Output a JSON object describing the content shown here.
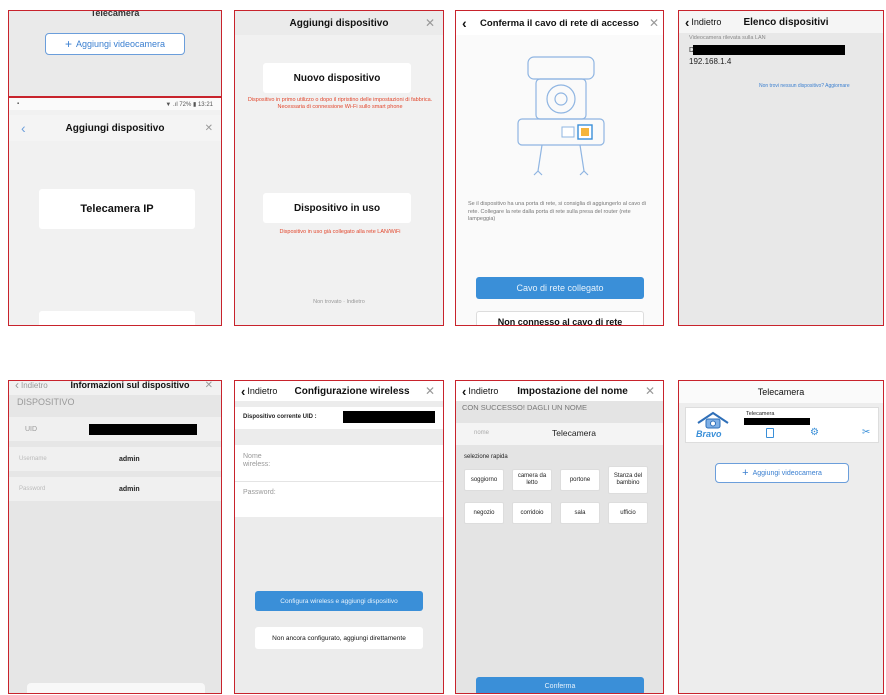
{
  "p1": {
    "top_title": "Telecamera",
    "add_camera_label": "Aggiungi videocamera",
    "status_icon": "notification-icon",
    "status_right": "▼ .ıl 72% ▮ 13:21",
    "header_title": "Aggiungi dispositivo",
    "camera_option": "Telecamera IP"
  },
  "p2": {
    "header_title": "Aggiungi dispositivo",
    "new_device": "Nuovo dispositivo",
    "new_device_note": "Dispositivo in primo utilizzo o dopo il ripristino delle impostazioni di fabbrica. Necessaria di connessione Wi-Fi sullo smart phone",
    "in_use_device": "Dispositivo in uso",
    "in_use_note": "Dispositivo in uso già collegato alla rete LAN/WiFi",
    "footer_text": "Non trovato · Indietro"
  },
  "p3": {
    "header_title": "Conferma il cavo di rete di accesso",
    "instruction": "Se il dispositivo ha una porta di rete, si consiglia di aggiungerlo al cavo di rete. Collegare la rete dalla porta di rete sulla presa del router (rete lampeggia)",
    "connected_button": "Cavo di rete collegato",
    "not_connected_button": "Non connesso al cavo di rete"
  },
  "p4": {
    "back_label": "Indietro",
    "header_title": "Elenco dispositivi",
    "lan_label": "Videocamera rilevata sulla LAN",
    "device_prefix": "D",
    "ip": "192.168.1.4",
    "link": "Non trovi nessun dispositivo? Aggiornare"
  },
  "p5": {
    "back_label": "Indietro",
    "header_title": "Informazioni sul dispositivo",
    "section_label": "DISPOSITIVO",
    "uid_label": "UID",
    "username_label": "Username",
    "username_value": "admin",
    "password_label": "Password",
    "password_value": "admin"
  },
  "p6": {
    "back_label": "Indietro",
    "header_title": "Configurazione wireless",
    "uid_label": "Dispositivo corrente UID :",
    "wifi_name_label": "Nome wireless:",
    "password_label": "Password:",
    "configure_button": "Configura wireless e aggiungi dispositivo",
    "skip_button": "Non ancora configurato, aggiungi direttamente"
  },
  "p7": {
    "back_label": "Indietro",
    "header_title": "Impostazione del nome",
    "success_text": "CON SUCCESSO! DAGLI UN NOME",
    "name_label": "nome",
    "name_value": "Telecamera",
    "quick_label": "selezione rapida",
    "chips": [
      "soggiorno",
      "camera da letto",
      "portone",
      "Stanza del bambino",
      "negozio",
      "corridoio",
      "sala",
      "ufficio"
    ],
    "confirm_button": "Conferma"
  },
  "p8": {
    "header_title": "Telecamera",
    "brand_text": "Bravo",
    "camera_name": "Telecamera",
    "add_camera_label": "Aggiungi videocamera",
    "icons": [
      "sd-card-icon",
      "settings-icon",
      "tools-icon"
    ]
  },
  "colors": {
    "frame": "#c8232c",
    "accent": "#3a8fd8",
    "note_red": "#e2462c"
  }
}
